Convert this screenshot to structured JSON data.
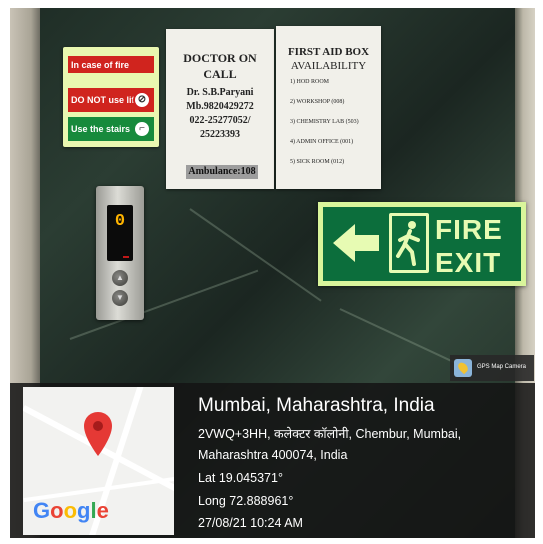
{
  "fire_sign": {
    "rows": [
      "In case of fire",
      "DO NOT use lift",
      "Use the stairs"
    ],
    "colors": {
      "red": "#d0241e",
      "green": "#178a3c",
      "backing": "#e9f7b0"
    }
  },
  "doctor_notice": {
    "title_line1": "DOCTOR ON",
    "title_line2": "CALL",
    "name": "Dr. S.B.Paryani",
    "mobile": "Mb.9820429272",
    "phone1": "022-25277052/",
    "phone2": "25223393",
    "ambulance": "Ambulance:108"
  },
  "first_aid_notice": {
    "title": "FIRST AID BOX",
    "subtitle": "AVAILABILITY",
    "items": [
      "1) HOD ROOM",
      "2) WORKSHOP (008)",
      "3) CHEMISTRY LAB (503)",
      "4) ADMIN OFFICE (001)",
      "5) SICK ROOM (012)"
    ]
  },
  "elevator": {
    "floor_display": "0",
    "up_icon": "up-arrow-icon",
    "down_icon": "down-arrow-icon"
  },
  "fire_exit_sign": {
    "line1": "FIRE",
    "line2": "EXIT",
    "colors": {
      "background": "#0c6e3c",
      "glow": "#e7fbb3"
    }
  },
  "gps": {
    "app_label": "GPS Map Camera",
    "city": "Mumbai, Maharashtra, India",
    "address_line1": "2VWQ+3HH, कलेक्टर कॉलोनी, Chembur, Mumbai,",
    "address_line2": "Maharashtra 400074, India",
    "lat": "Lat 19.045371°",
    "long": "Long 72.888961°",
    "datetime": "27/08/21 10:24 AM",
    "map_logo": "Google",
    "pin_color": "#e53935"
  }
}
